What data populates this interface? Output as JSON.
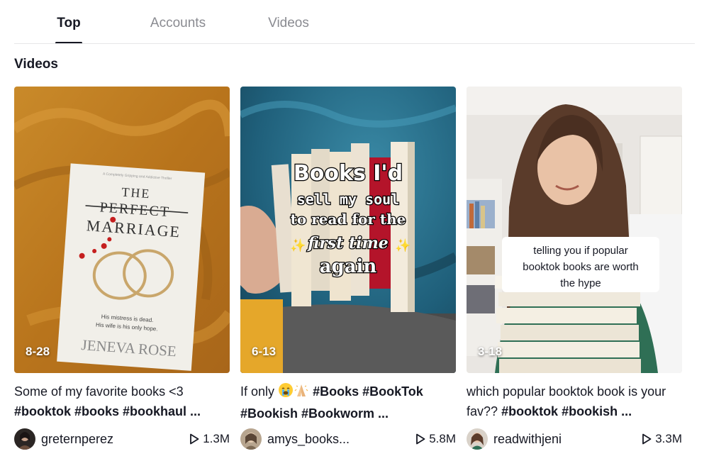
{
  "tabs": [
    {
      "label": "Top",
      "active": true
    },
    {
      "label": "Accounts",
      "active": false
    },
    {
      "label": "Videos",
      "active": false
    }
  ],
  "section_title": "Videos",
  "videos": [
    {
      "date": "8-28",
      "desc_text": "Some of my favorite books <3",
      "desc_tags": "#booktok #books #bookhaul ...",
      "username": "greternperez",
      "views": "1.3M",
      "thumb_text": {
        "publisher_line": "A Completely Gripping and Addictive Thriller",
        "book_title_1": "THE",
        "book_title_2": "PERFECT",
        "book_title_3": "MARRIAGE",
        "tagline_1": "His mistress is dead.",
        "tagline_2": "His wife is his only hope.",
        "author": "JENEVA ROSE"
      }
    },
    {
      "date": "6-13",
      "desc_text": "If only",
      "desc_tags": "#Books #BookTok #Bookish #Bookworm ...",
      "username": "amys_books...",
      "views": "5.8M",
      "thumb_text": {
        "line_1": "Books I'd",
        "line_2": "sell my soul",
        "line_3": "to read for the",
        "line_4": "first time",
        "line_5": "again"
      }
    },
    {
      "date": "3-18",
      "desc_text": "which popular booktok book is your fav??",
      "desc_tags": "#booktok #bookish ...",
      "username": "readwithjeni",
      "views": "3.3M",
      "thumb_text": {
        "line_1": "telling you if popular",
        "line_2": "booktok books are worth",
        "line_3": "the hype"
      }
    }
  ],
  "icons": {
    "play": "play-icon",
    "emoji_1": "crying-face-icon",
    "emoji_2": "folded-hands-icon"
  },
  "colors": {
    "text": "#161823",
    "inactive_tab": "#8a8b91",
    "divider": "#e6e6e8"
  }
}
